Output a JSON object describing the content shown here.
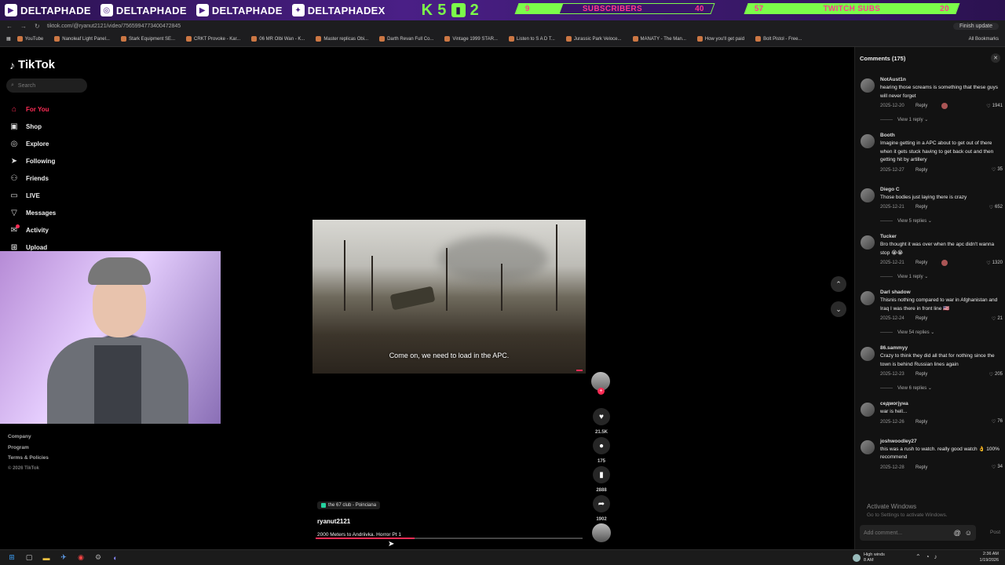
{
  "banner": {
    "socials": [
      {
        "icon": "twitch-icon",
        "label": "DELTAPHADE"
      },
      {
        "icon": "instagram-icon",
        "label": "DELTAPHADE"
      },
      {
        "icon": "youtube-icon",
        "label": "DELTAPHADE"
      },
      {
        "icon": "twitter-icon",
        "label": "DELTAPHADEX"
      }
    ],
    "kick_count": "K 5",
    "twitch_count": "2",
    "subscribers": {
      "current": "9",
      "label": "SUBSCRIBERS",
      "goal": "40",
      "progress": 0.225
    },
    "twitch_subs": {
      "current": "57",
      "label": "TWITCH SUBS",
      "goal": "20",
      "progress": 1.0
    }
  },
  "browser": {
    "url": "tiktok.com/@ryanut2121/video/7565994773400472845",
    "update_label": "Finish update",
    "all_bookmarks": "All Bookmarks",
    "bookmarks": [
      "YouTube",
      "Nanoleaf Light Panel...",
      "Stark Equipment SE...",
      "CRKT Provoke - Kar...",
      "06 MR Olbi Wan - K...",
      "Master replicas Obi...",
      "Darth Revan Full Co...",
      "Vintage 1999 STAR...",
      "Listen to S A D T...",
      "Jurassic Park Veloce...",
      "MANATY - The Man...",
      "How you'll get paid",
      "Bolt Pistol - Free..."
    ]
  },
  "tiktok": {
    "logo": "TikTok",
    "search_placeholder": "Search",
    "nav": [
      {
        "icon": "home-icon",
        "label": "For You",
        "active": true
      },
      {
        "icon": "shop-icon",
        "label": "Shop"
      },
      {
        "icon": "compass-icon",
        "label": "Explore"
      },
      {
        "icon": "arrow-icon",
        "label": "Following"
      },
      {
        "icon": "friends-icon",
        "label": "Friends"
      },
      {
        "icon": "live-icon",
        "label": "LIVE"
      },
      {
        "icon": "messages-icon",
        "label": "Messages"
      },
      {
        "icon": "activity-icon",
        "label": "Activity",
        "badge": true
      },
      {
        "icon": "upload-icon",
        "label": "Upload"
      }
    ],
    "footer": [
      "Company",
      "Program",
      "Terms & Policies"
    ],
    "copyright": "© 2026 TikTok"
  },
  "video": {
    "subtitle": "Come on, we need to load in the APC.",
    "likes": "21.5K",
    "comments": "175",
    "saves": "2888",
    "shares": "1902",
    "location": "the 67 club - Poinciana",
    "author": "ryanut2121",
    "description": "2000 Meters to Andriivka. Horror Pt 1",
    "progress": 0.37
  },
  "comments": {
    "header": "Comments (175)",
    "input_placeholder": "Add comment...",
    "post_label": "Post",
    "items": [
      {
        "user": "NotAust1n",
        "text": "hearing those screams is something that these guys will never forget",
        "date": "2025-12-20",
        "reply": "Reply",
        "likes": "1941",
        "creator_liked": true,
        "view_replies": "View 1 reply"
      },
      {
        "user": "Booth",
        "text": "Imagine getting in a APC about to get out of there when it gets stuck having to get back out and then getting hit by artillery",
        "date": "2025-12-27",
        "reply": "Reply",
        "likes": "35"
      },
      {
        "user": "Diego C",
        "text": "Those bodies just laying there is crazy",
        "date": "2025-12-21",
        "reply": "Reply",
        "likes": "652",
        "view_replies": "View 5 replies"
      },
      {
        "user": "Tucker",
        "text": "Bro thought it was over when the apc didn't wanna stop 😭😭",
        "date": "2025-12-21",
        "reply": "Reply",
        "likes": "1320",
        "creator_liked": true,
        "view_replies": "View 1 reply"
      },
      {
        "user": "Darl shadow",
        "text": "Thisnis nothing compared to war in Afghanistan and Iraq I was there in front line 🇺🇸",
        "date": "2025-12-24",
        "reply": "Reply",
        "likes": "21",
        "view_replies": "View 54 replies"
      },
      {
        "user": "86.sammyy",
        "text": "Crazy to think they did all that for nothing since the town is behind Russian lines again",
        "date": "2025-12-23",
        "reply": "Reply",
        "likes": "205",
        "view_replies": "View 6 replies"
      },
      {
        "user": "седмогјуна",
        "text": "war is hell...",
        "date": "2025-12-26",
        "reply": "Reply",
        "likes": "76"
      },
      {
        "user": "joshwoodley27",
        "text": "this was a rush to watch. really good watch 👌 100% recommend",
        "date": "2025-12-28",
        "reply": "Reply",
        "likes": "34"
      }
    ]
  },
  "windows": {
    "activate_title": "Activate Windows",
    "activate_sub": "Go to Settings to activate Windows.",
    "weather_label": "High winds",
    "weather_sub": "8 AM",
    "time": "2:36 AM",
    "date": "1/19/2026"
  }
}
